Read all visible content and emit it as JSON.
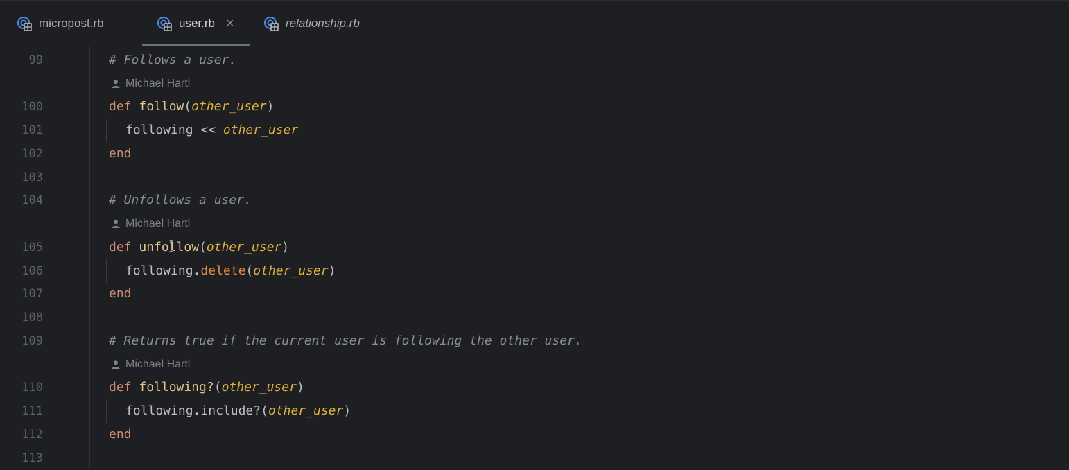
{
  "tabs": [
    {
      "label": "micropost.rb",
      "icon": "ruby-file-icon"
    },
    {
      "label": "user.rb",
      "icon": "ruby-file-icon",
      "active": true,
      "close": "×"
    },
    {
      "label": "relationship.rb",
      "icon": "ruby-file-icon"
    }
  ],
  "author": "Michael Hartl",
  "lines": {
    "n99": "99",
    "n100": "100",
    "n101": "101",
    "n102": "102",
    "n103": "103",
    "n104": "104",
    "n105": "105",
    "n106": "106",
    "n107": "107",
    "n108": "108",
    "n109": "109",
    "n110": "110",
    "n111": "111",
    "n112": "112",
    "n113": "113"
  },
  "code": {
    "c99": "# Follows a user.",
    "kw_def": "def",
    "kw_end": "end",
    "f_follow": "follow",
    "f_unfollow": "unfollow",
    "f_following_q": "following?",
    "param": "other_user",
    "paren_open": "(",
    "paren_close": ")",
    "following": "following",
    "op_shift": " << ",
    "dot": ".",
    "m_delete": "delete",
    "m_include": "include?",
    "c104": "# Unfollows a user.",
    "c109": "# Returns true if the current user is following the other user."
  },
  "colors": {
    "background": "#1e1f22",
    "keyword": "#cf8e6d",
    "function": "#e0c48a",
    "parameter": "#dfb13a",
    "comment": "#8b8e94"
  }
}
